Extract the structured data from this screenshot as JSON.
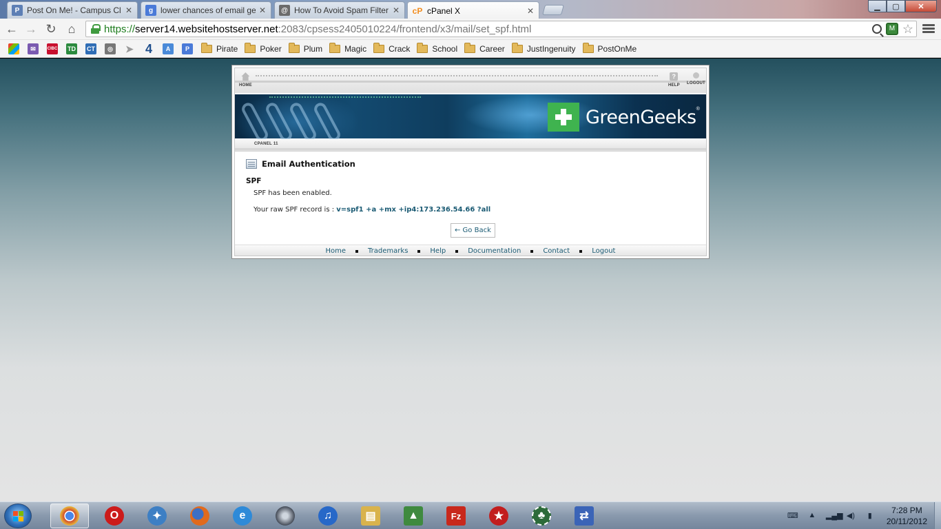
{
  "browser": {
    "tabs": [
      {
        "label": "Post On Me! - Campus Cl",
        "icon": "pinterest-like-icon",
        "color": "#5d7fb5",
        "glyph": "P"
      },
      {
        "label": "lower chances of email ge",
        "icon": "google-icon",
        "color": "#4a7ad8",
        "glyph": "g"
      },
      {
        "label": "How To Avoid Spam Filter",
        "icon": "mailchimp-icon",
        "color": "#6b6b6b",
        "glyph": "@"
      },
      {
        "label": "cPanel X",
        "icon": "cpanel-icon",
        "color": "#f28c1d",
        "glyph": "cP"
      }
    ],
    "url": {
      "scheme": "https://",
      "host": "server14.websitehostserver.net",
      "path": ":2083/cpsess2405010224/frontend/x3/mail/set_spf.html"
    },
    "bookmarks": {
      "icons": [
        {
          "name": "windows-icon",
          "color": "#e8492a"
        },
        {
          "name": "yahoo-mail-icon",
          "color": "#7a5ab0"
        },
        {
          "name": "cibc-icon",
          "color": "#c8102e",
          "text": "CIBC"
        },
        {
          "name": "td-icon",
          "color": "#2b8a3e",
          "text": "TD"
        },
        {
          "name": "ct-icon",
          "color": "#2f6db5",
          "text": "CT"
        },
        {
          "name": "owl-icon",
          "color": "#777777"
        },
        {
          "name": "paper-plane-icon",
          "color": "#999999"
        },
        {
          "name": "four-icon",
          "color": "#1f4e8c",
          "text": "4"
        },
        {
          "name": "a-icon",
          "color": "#4a8ad8",
          "text": "A"
        },
        {
          "name": "p-icon",
          "color": "#4a7ad8",
          "text": "P"
        }
      ],
      "folders": [
        "Pirate",
        "Poker",
        "Plum",
        "Magic",
        "Crack",
        "School",
        "Career",
        "JustIngenuity",
        "PostOnMe"
      ]
    }
  },
  "cpanel": {
    "nav": {
      "home": "HOME",
      "help": "HELP",
      "logout": "LOGOUT"
    },
    "brand": "GreenGeeks",
    "brand_mark": "®",
    "version_tag": "CPANEL 11",
    "page_title": "Email Authentication",
    "section": "SPF",
    "status_message": "SPF has been enabled.",
    "record_label": "Your raw SPF record is : ",
    "record_value": "v=spf1 +a +mx +ip4:173.236.54.66 ?all",
    "go_back": "← Go Back",
    "footer": [
      "Home",
      "Trademarks",
      "Help",
      "Documentation",
      "Contact",
      "Logout"
    ]
  },
  "taskbar": {
    "apps": [
      {
        "name": "chrome",
        "color": "#d04a2d",
        "glyph": "◉",
        "active": true
      },
      {
        "name": "opera",
        "color": "#cc1b1b",
        "glyph": "O"
      },
      {
        "name": "safari",
        "color": "#3d7fc4",
        "glyph": "✦"
      },
      {
        "name": "firefox",
        "color": "#e06a1d",
        "glyph": "●"
      },
      {
        "name": "internet-explorer",
        "color": "#2e8ad8",
        "glyph": "e"
      },
      {
        "name": "media-sphere",
        "color": "#444b57",
        "glyph": "◍"
      },
      {
        "name": "itunes",
        "color": "#2768c8",
        "glyph": "♫"
      },
      {
        "name": "file-explorer",
        "color": "#d9b34c",
        "glyph": "▤"
      },
      {
        "name": "chart-app",
        "color": "#3f8a3f",
        "glyph": "▲"
      },
      {
        "name": "filezilla",
        "color": "#c8281c",
        "glyph": "Fz"
      },
      {
        "name": "pokerstars",
        "color": "#c21e1e",
        "glyph": "★"
      },
      {
        "name": "poker-chip",
        "color": "#2d6b3a",
        "glyph": "♣"
      },
      {
        "name": "network-app",
        "color": "#3b64b7",
        "glyph": "⇄"
      }
    ],
    "time": "7:28 PM",
    "date": "20/11/2012"
  }
}
